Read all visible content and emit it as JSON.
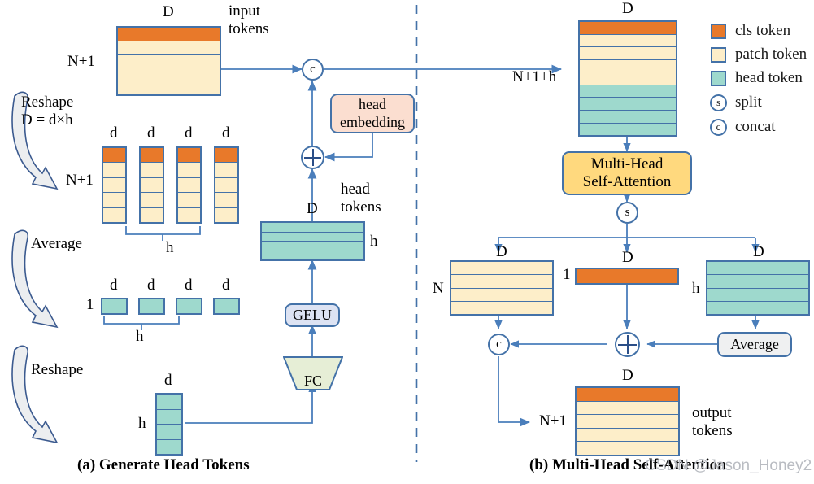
{
  "figure": {
    "panel_a_caption": "(a) Generate Head Tokens",
    "panel_b_caption": "(b) Multi-Head Self-Attention",
    "watermark": "CSDN @Jason_Honey2"
  },
  "colors": {
    "cls_token": "#e8792a",
    "patch_token": "#fdeec9",
    "head_token": "#9ed9cd",
    "border": "#4472a8",
    "arrow": "#4a7ebb",
    "head_embedding_box": "#fbded0",
    "gelu_box": "#dde3f3",
    "fc_box": "#e6eed6",
    "mhsa_box": "#ffd97e",
    "average_box": "#eff0f1",
    "divider": "#4472a8"
  },
  "legend": {
    "items": [
      {
        "swatch": "cls-token-swatch",
        "label": "cls token",
        "kind": "square",
        "color": "#e8792a"
      },
      {
        "swatch": "patch-token-swatch",
        "label": "patch token",
        "kind": "square",
        "color": "#fdeec9"
      },
      {
        "swatch": "head-token-swatch",
        "label": "head token",
        "kind": "square",
        "color": "#9ed9cd"
      },
      {
        "swatch": "split-symbol",
        "label": "split",
        "kind": "circle",
        "glyph": "s"
      },
      {
        "swatch": "concat-symbol",
        "label": "concat",
        "kind": "circle",
        "glyph": "c"
      }
    ]
  },
  "panel_a": {
    "input_tokens": {
      "top_label": "D",
      "left_label": "N+1",
      "caption": "input\ntokens",
      "caption_line1": "input",
      "caption_line2": "tokens",
      "rows": [
        "cls",
        "patch",
        "patch",
        "patch",
        "patch"
      ]
    },
    "reshape_1": {
      "line1": "Reshape",
      "line2": "D = d×h"
    },
    "reshaped_columns": {
      "left_label": "N+1",
      "col_top_labels": [
        "d",
        "d",
        "d",
        "d"
      ],
      "brace_label": "h",
      "rows_per_column": [
        "cls",
        "patch",
        "patch",
        "patch",
        "patch"
      ],
      "column_count": 4
    },
    "average_step": {
      "label": "Average"
    },
    "averaged_row": {
      "left_label": "1",
      "col_top_labels": [
        "d",
        "d",
        "d",
        "d"
      ],
      "brace_label": "h",
      "column_count": 4
    },
    "reshape_2": {
      "label": "Reshape"
    },
    "head_column": {
      "top_label": "d",
      "left_label": "h",
      "row_count": 4
    },
    "fc": {
      "label": "FC"
    },
    "gelu": {
      "label": "GELU"
    },
    "head_tokens_block": {
      "top_label": "D",
      "right_label": "h",
      "caption_line1": "head",
      "caption_line2": "tokens",
      "row_count": 4
    },
    "head_embedding": {
      "line1": "head",
      "line2": "embedding"
    },
    "add_op": {
      "glyph": "+"
    },
    "concat_op": {
      "glyph": "c"
    }
  },
  "panel_b": {
    "combined_tokens": {
      "top_label": "D",
      "left_label": "N+1+h",
      "rows": [
        "cls",
        "patch",
        "patch",
        "patch",
        "patch",
        "head",
        "head",
        "head",
        "head"
      ]
    },
    "mhsa": {
      "line1": "Multi-Head",
      "line2": "Self-Attention"
    },
    "split_op": {
      "glyph": "s"
    },
    "patch_branch": {
      "top_label": "D",
      "left_label": "N",
      "row_count": 4
    },
    "cls_branch": {
      "top_label": "D",
      "left_label": "1",
      "row_count": 1
    },
    "head_branch": {
      "top_label": "D",
      "left_label": "h",
      "row_count": 4
    },
    "average": {
      "label": "Average"
    },
    "add_op": {
      "glyph": "+"
    },
    "concat_op": {
      "glyph": "c"
    },
    "output_tokens": {
      "top_label": "D",
      "left_label": "N+1",
      "caption_line1": "output",
      "caption_line2": "tokens",
      "rows": [
        "cls",
        "patch",
        "patch",
        "patch",
        "patch"
      ]
    }
  }
}
